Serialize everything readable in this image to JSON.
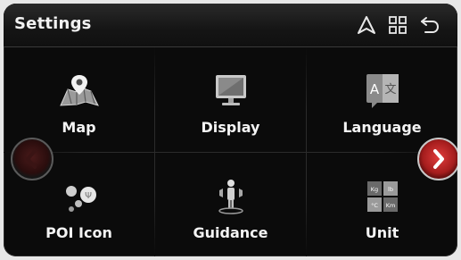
{
  "header": {
    "title": "Settings",
    "icons": [
      "navigation-arrow-icon",
      "grid-menu-icon",
      "back-icon"
    ]
  },
  "tiles": [
    {
      "label": "Map",
      "icon": "map-pin-icon"
    },
    {
      "label": "Display",
      "icon": "monitor-icon"
    },
    {
      "label": "Language",
      "icon": "language-icon"
    },
    {
      "label": "POI Icon",
      "icon": "poi-icon"
    },
    {
      "label": "Guidance",
      "icon": "guidance-icon"
    },
    {
      "label": "Unit",
      "icon": "unit-icon",
      "unit_icon_text": [
        "Kg",
        "lb",
        "°C",
        "Km"
      ]
    }
  ],
  "colors": {
    "accent_red": "#c52a2a",
    "background": "#0b0b0b",
    "text": "#f4f4f4"
  }
}
